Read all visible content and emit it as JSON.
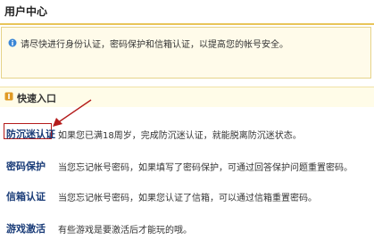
{
  "header": {
    "title": "用户中心"
  },
  "notice": {
    "icon": "info-icon",
    "text": "请尽快进行身份认证，密码保护和信箱认证，以提高您的帐号安全。"
  },
  "quick_entry": {
    "icon": "bullet-icon",
    "title": "快速入口",
    "items": [
      {
        "label": "防沉迷认证",
        "desc": "如果您已满18周岁，完成防沉迷认证，就能脱离防沉迷状态。"
      },
      {
        "label": "密码保护",
        "desc": "当您忘记帐号密码，如果填写了密码保护，可通过回答保护问题重置密码。"
      },
      {
        "label": "信箱认证",
        "desc": "当您忘记帐号密码，如果您认证了信箱，可以通过信箱重置密码。"
      },
      {
        "label": "游戏激活",
        "desc": "有些游戏是要激活后才能玩的哦。"
      }
    ]
  },
  "colors": {
    "accent_rule": "#e8c55a",
    "highlight": "#b41b1b",
    "link": "#1a3c78",
    "notice_bg": "#fffbea"
  }
}
